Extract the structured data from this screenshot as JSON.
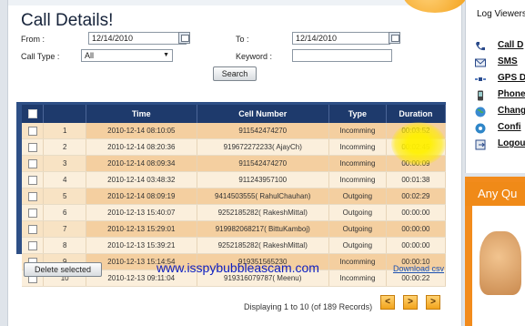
{
  "page": {
    "title": "Call Details!",
    "from_label": "From :",
    "from_value": "12/14/2010",
    "to_label": "To :",
    "to_value": "12/14/2010",
    "calltype_label": "Call Type :",
    "calltype_value": "All",
    "keyword_label": "Keyword :",
    "keyword_value": "",
    "search_button": "Search",
    "delete_button": "Delete selected",
    "download_link": "Download csv",
    "displaying_text": "Displaying 1 to 10 (of 189 Records)",
    "watermark": "www.isspybubbleascam.com",
    "pager": {
      "first": "<",
      "next": ">",
      "last": ">"
    }
  },
  "table": {
    "headers": [
      "",
      "Time",
      "Cell Number",
      "Type",
      "Duration"
    ],
    "rows": [
      {
        "n": "1",
        "time": "2010-12-14 08:10:05",
        "number": "911542474270",
        "type": "Incomming",
        "duration": "00:03:52"
      },
      {
        "n": "2",
        "time": "2010-12-14 08:20:36",
        "number": "919672272233( AjayCh)",
        "type": "Incomming",
        "duration": "00:02:45"
      },
      {
        "n": "3",
        "time": "2010-12-14 08:09:34",
        "number": "911542474270",
        "type": "Incomming",
        "duration": "00:00:09"
      },
      {
        "n": "4",
        "time": "2010-12-14 03:48:32",
        "number": "911243957100",
        "type": "Incomming",
        "duration": "00:01:38"
      },
      {
        "n": "5",
        "time": "2010-12-14 08:09:19",
        "number": "9414503555( RahulChauhan)",
        "type": "Outgoing",
        "duration": "00:02:29"
      },
      {
        "n": "6",
        "time": "2010-12-13 15:40:07",
        "number": "9252185282( RakeshMittal)",
        "type": "Outgoing",
        "duration": "00:00:00"
      },
      {
        "n": "7",
        "time": "2010-12-13 15:29:01",
        "number": "919982068217( BittuKamboj)",
        "type": "Outgoing",
        "duration": "00:00:00"
      },
      {
        "n": "8",
        "time": "2010-12-13 15:39:21",
        "number": "9252185282( RakeshMittal)",
        "type": "Outgoing",
        "duration": "00:00:00"
      },
      {
        "n": "9",
        "time": "2010-12-13 15:14:54",
        "number": "919351565230",
        "type": "Incomming",
        "duration": "00:00:10"
      },
      {
        "n": "10",
        "time": "2010-12-13 09:11:04",
        "number": "919316079787( Meenu)",
        "type": "Incomming",
        "duration": "00:00:22"
      }
    ]
  },
  "sidebar": {
    "title": "Log Viewers",
    "items": [
      {
        "label": "Call D",
        "icon": "phone-icon"
      },
      {
        "label": "SMS",
        "icon": "mail-icon"
      },
      {
        "label": "GPS D",
        "icon": "satellite-icon"
      },
      {
        "label": "Phone",
        "icon": "mobile-icon"
      },
      {
        "label": "Chang",
        "icon": "globe-icon"
      },
      {
        "label": "Confi",
        "icon": "settings-icon"
      },
      {
        "label": "Logou",
        "icon": "logout-icon"
      }
    ]
  },
  "ad": {
    "headline": "Any Qu"
  },
  "colors": {
    "header_bg": "#1e3a6c",
    "row_odd": "#f4cfa0",
    "row_even": "#fbefdc",
    "accent": "#f2a31b",
    "watermark": "#1020c0"
  }
}
